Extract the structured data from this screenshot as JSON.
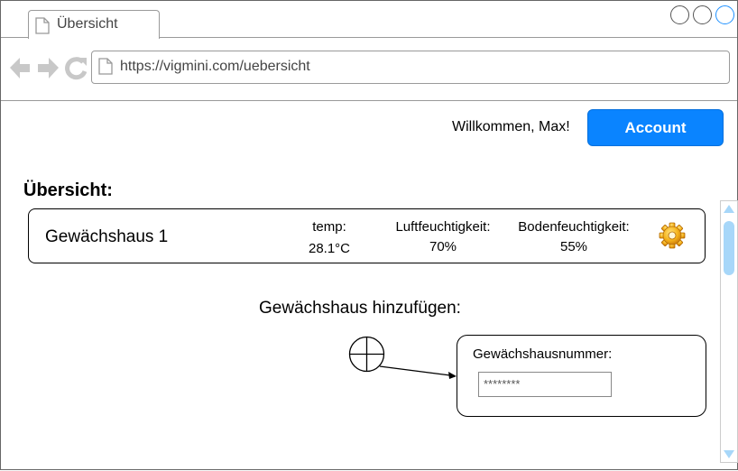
{
  "browser": {
    "tab_title": "Übersicht",
    "url": "https://vigmini.com/uebersicht"
  },
  "header": {
    "welcome": "Willkommen, Max!",
    "account_button": "Account"
  },
  "overview": {
    "title": "Übersicht:",
    "greenhouses": [
      {
        "name": "Gewächshaus 1",
        "temp_label": "temp:",
        "temp_value": "28.1°C",
        "air_label": "Luftfeuchtigkeit:",
        "air_value": "70%",
        "soil_label": "Bodenfeuchtigkeit:",
        "soil_value": "55%",
        "settings_icon": "gear-icon"
      }
    ]
  },
  "add_greenhouse": {
    "title": "Gewächshaus hinzufügen:",
    "add_icon": "plus-circle-icon",
    "field_label": "Gewächshausnummer:",
    "field_value": "********"
  },
  "colors": {
    "accent": "#0a84ff",
    "scroll_thumb": "#a7d7f9"
  }
}
